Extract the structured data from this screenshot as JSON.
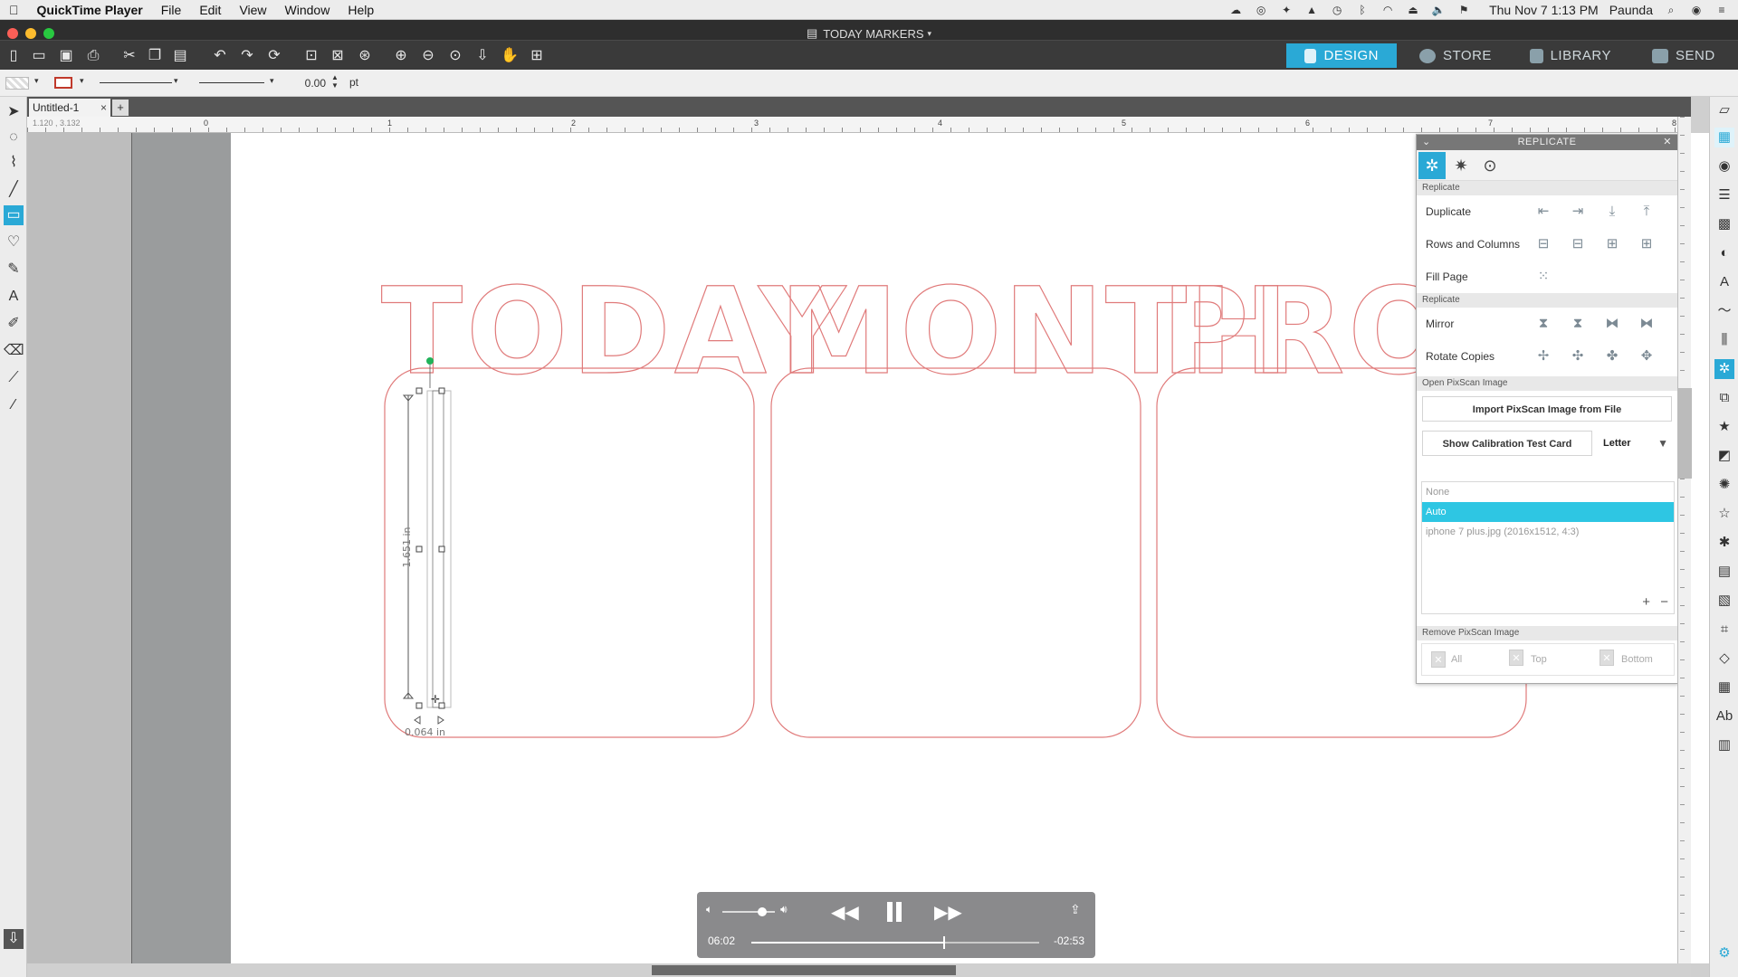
{
  "menubar": {
    "app_name": "QuickTime Player",
    "items": [
      "File",
      "Edit",
      "View",
      "Window",
      "Help"
    ],
    "datetime": "Thu Nov 7  1:13 PM",
    "user": "Paunda"
  },
  "window": {
    "title": "TODAY MARKERS"
  },
  "nav_tabs": [
    {
      "label": "DESIGN",
      "active": true
    },
    {
      "label": "STORE",
      "active": false
    },
    {
      "label": "LIBRARY",
      "active": false
    },
    {
      "label": "SEND",
      "active": false
    }
  ],
  "propbar": {
    "line_width": "0.00",
    "unit": "pt"
  },
  "doc_tab": {
    "name": "Untitled-1",
    "close": "×",
    "add": "+"
  },
  "ruler": {
    "coords": "1.120 , 3.132",
    "labels": [
      "0",
      "1",
      "2",
      "3",
      "4",
      "5",
      "6",
      "7",
      "8"
    ]
  },
  "canvas": {
    "words": [
      "TODAY",
      "MONTH",
      "PROJEC"
    ],
    "measure_height": "1.651 in",
    "measure_width": "0.064 in",
    "outline_color": "#e07a7a"
  },
  "replicate_panel": {
    "title": "REPLICATE",
    "section_replicate": "Replicate",
    "duplicate": "Duplicate",
    "rows_columns": "Rows and Columns",
    "fill_page": "Fill Page",
    "section_replicate2": "Replicate",
    "mirror": "Mirror",
    "rotate_copies": "Rotate Copies",
    "section_pixscan": "Open PixScan Image",
    "import_btn": "Import PixScan Image from File",
    "calibration_btn": "Show Calibration Test Card",
    "paper_select": "Letter",
    "list_items": [
      "None",
      "Auto",
      "iphone 7 plus.jpg (2016x1512, 4:3)"
    ],
    "list_selected": "Auto",
    "section_remove": "Remove PixScan Image",
    "remove_all": "All",
    "remove_top": "Top",
    "remove_bottom": "Bottom"
  },
  "player": {
    "elapsed": "06:02",
    "remaining": "-02:53",
    "progress": 0.67,
    "volume": 0.75
  }
}
